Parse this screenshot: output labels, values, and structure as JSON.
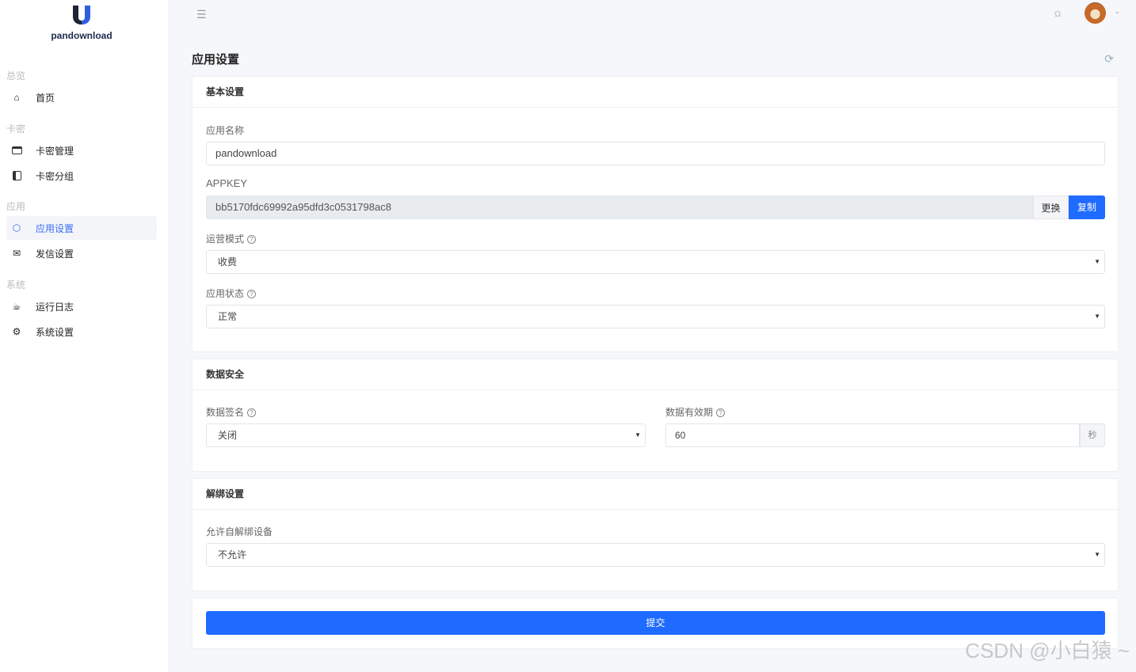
{
  "brand": {
    "name": "pandownload"
  },
  "sidebar": {
    "groups": [
      {
        "label": "总览",
        "items": [
          {
            "label": "首页",
            "icon": "home-icon"
          }
        ]
      },
      {
        "label": "卡密",
        "items": [
          {
            "label": "卡密管理",
            "icon": "card-icon"
          },
          {
            "label": "卡密分组",
            "icon": "panel-icon"
          }
        ]
      },
      {
        "label": "应用",
        "items": [
          {
            "label": "应用设置",
            "icon": "cube-icon",
            "active": true
          },
          {
            "label": "发信设置",
            "icon": "mail-icon"
          }
        ]
      },
      {
        "label": "系统",
        "items": [
          {
            "label": "运行日志",
            "icon": "cup-icon"
          },
          {
            "label": "系统设置",
            "icon": "gear-icon"
          }
        ]
      }
    ]
  },
  "page": {
    "title": "应用设置"
  },
  "basic": {
    "title": "基本设置",
    "app_name_label": "应用名称",
    "app_name": "pandownload",
    "appkey_label": "APPKEY",
    "appkey": "bb5170fdc69992a95dfd3c0531798ac8",
    "change": "更换",
    "copy": "复制",
    "mode_label": "运营模式",
    "mode": "收费",
    "status_label": "应用状态",
    "status": "正常"
  },
  "security": {
    "title": "数据安全",
    "sign_label": "数据签名",
    "sign": "关闭",
    "expire_label": "数据有效期",
    "expire": "60",
    "unit": "秒"
  },
  "unbind": {
    "title": "解绑设置",
    "allow_label": "允许自解绑设备",
    "allow": "不允许"
  },
  "submit": "提交",
  "colors": {
    "primary": "#1f6bff"
  },
  "watermark": "CSDN @小白猿 ~"
}
